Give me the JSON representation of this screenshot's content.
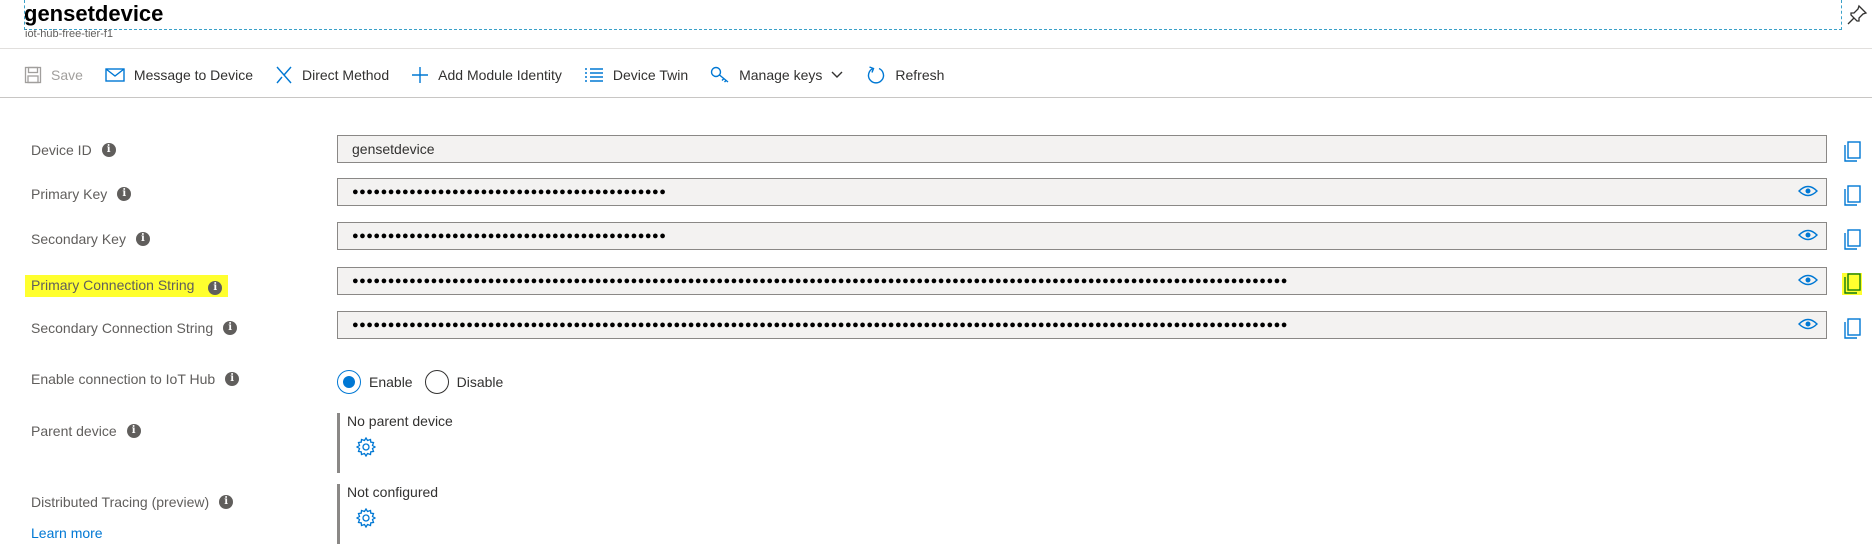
{
  "header": {
    "title": "gensetdevice",
    "subtitle": "iot-hub-free-tier-f1"
  },
  "toolbar": {
    "save": "Save",
    "message": "Message to Device",
    "direct": "Direct Method",
    "module": "Add Module Identity",
    "twin": "Device Twin",
    "keys": "Manage keys",
    "refresh": "Refresh"
  },
  "fields": {
    "device_id": {
      "label": "Device ID",
      "value": "gensetdevice"
    },
    "primary_key": {
      "label": "Primary Key",
      "value": "●●●●●●●●●●●●●●●●●●●●●●●●●●●●●●●●●●●●●●●●●●●●"
    },
    "secondary_key": {
      "label": "Secondary Key",
      "value": "●●●●●●●●●●●●●●●●●●●●●●●●●●●●●●●●●●●●●●●●●●●●"
    },
    "primary_conn": {
      "label": "Primary Connection String",
      "value": "●●●●●●●●●●●●●●●●●●●●●●●●●●●●●●●●●●●●●●●●●●●●●●●●●●●●●●●●●●●●●●●●●●●●●●●●●●●●●●●●●●●●●●●●●●●●●●●●●●●●●●●●●●●●●●●●●●●●●●●●●●●●●●●●●●●"
    },
    "secondary_conn": {
      "label": "Secondary Connection String",
      "value": "●●●●●●●●●●●●●●●●●●●●●●●●●●●●●●●●●●●●●●●●●●●●●●●●●●●●●●●●●●●●●●●●●●●●●●●●●●●●●●●●●●●●●●●●●●●●●●●●●●●●●●●●●●●●●●●●●●●●●●●●●●●●●●●●●●●"
    }
  },
  "connection": {
    "label": "Enable connection to IoT Hub",
    "enable": "Enable",
    "disable": "Disable",
    "selected": "Enable"
  },
  "parent": {
    "label": "Parent device",
    "value": "No parent device"
  },
  "tracing": {
    "label": "Distributed Tracing (preview)",
    "value": "Not configured",
    "learn_more": "Learn more"
  },
  "colors": {
    "accent": "#0078d4",
    "highlight": "#ffff2e"
  }
}
